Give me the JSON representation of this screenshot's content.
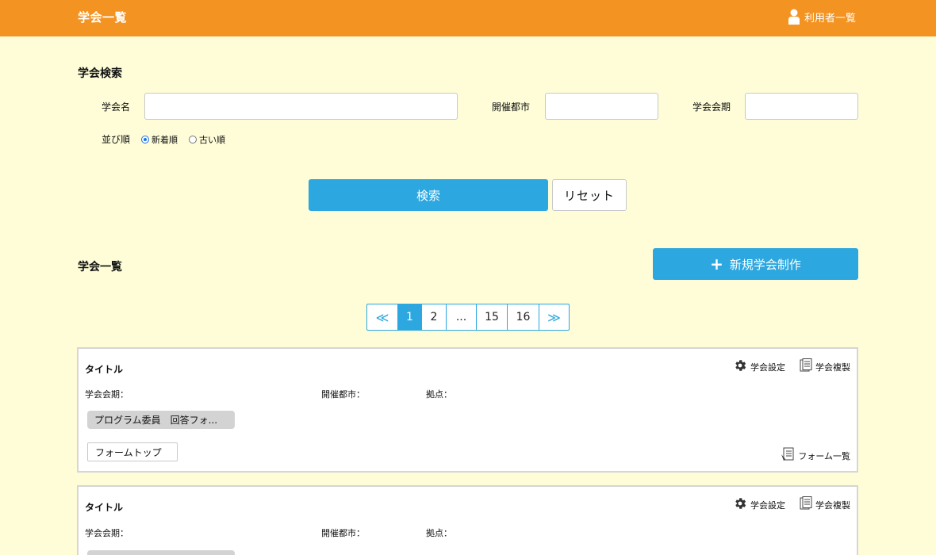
{
  "header": {
    "title": "学会一覧",
    "user_link_label": "利用者一覧"
  },
  "search": {
    "section_title": "学会検索",
    "name_label": "学会名",
    "name_value": "",
    "city_label": "開催都市",
    "city_value": "",
    "period_label": "学会会期",
    "period_value": "",
    "sort_label": "並び順",
    "sort_options": [
      "新着順",
      "古い順"
    ],
    "sort_selected": "新着順",
    "search_button": "検索",
    "reset_button": "リセット"
  },
  "list": {
    "section_title": "学会一覧",
    "new_button": "新規学会制作",
    "pagination": {
      "prev": "≪",
      "pages": [
        "1",
        "2",
        "...",
        "15",
        "16"
      ],
      "current": "1",
      "next": "≫"
    },
    "cards": [
      {
        "title": "タイトル",
        "settings_label": "学会設定",
        "copy_label": "学会複製",
        "period_label": "学会会期：",
        "city_label": "開催都市：",
        "base_label": "拠点：",
        "form_chip": "プログラム委員　回答フォ...",
        "form_top_button": "フォームトップ",
        "form_list_label": "フォーム一覧"
      },
      {
        "title": "タイトル",
        "settings_label": "学会設定",
        "copy_label": "学会複製",
        "period_label": "学会会期：",
        "city_label": "開催都市：",
        "base_label": "拠点："
      }
    ]
  },
  "colors": {
    "header": "#f39322",
    "background": "#fefdd8",
    "accent": "#2ca7df"
  }
}
